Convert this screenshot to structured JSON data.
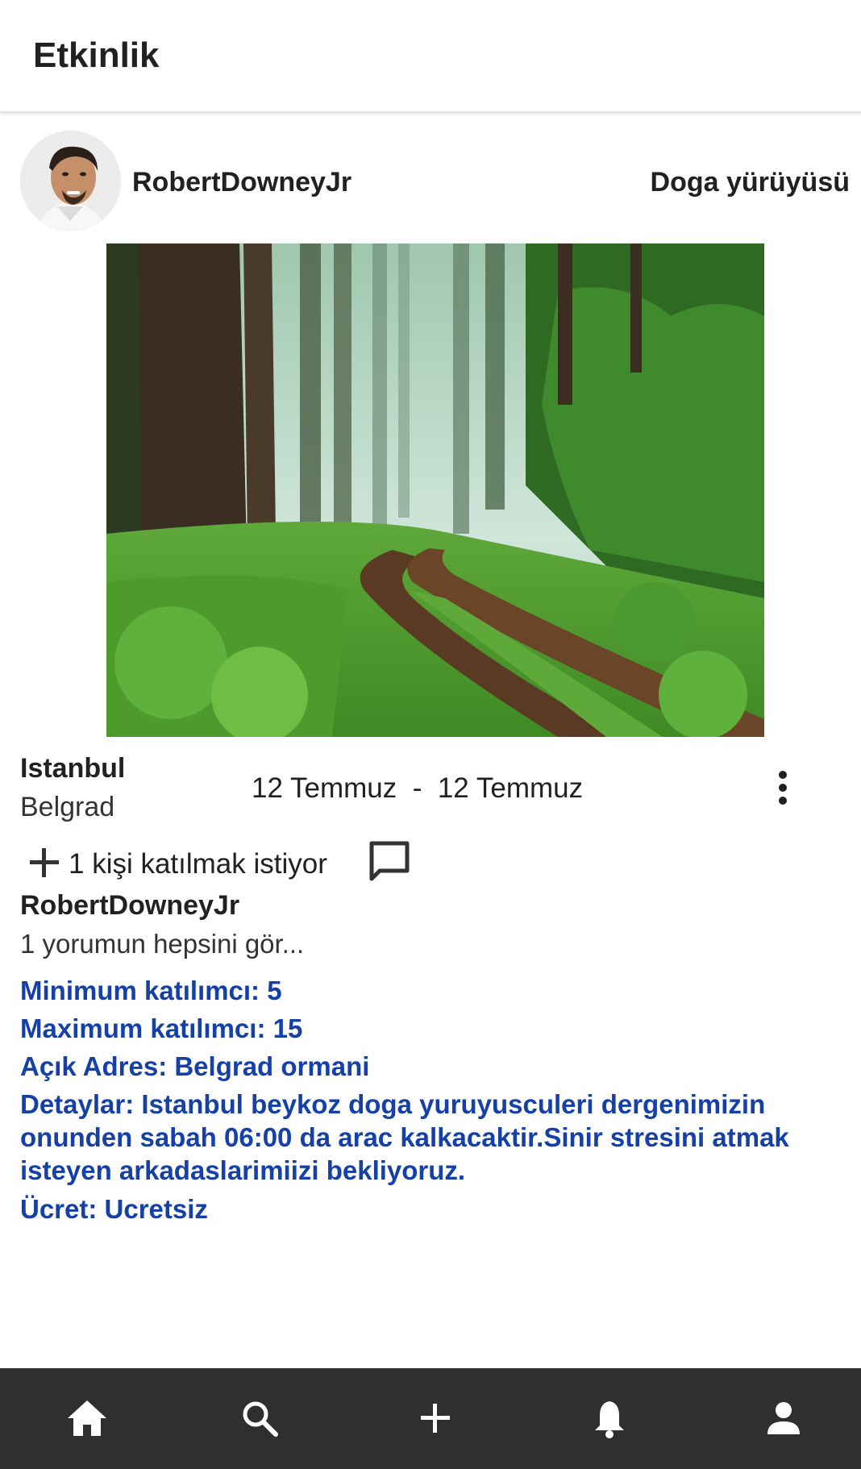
{
  "app_bar": {
    "title": "Etkinlik"
  },
  "post": {
    "username": "RobertDowneyJr",
    "event_name": "Doga yürüyüsü",
    "avatar_icon": "avatar-photo",
    "image_description_icon": "forest-photo"
  },
  "event": {
    "city": "Istanbul",
    "area": "Belgrad",
    "start_date": "12 Temmuz",
    "separator": "-",
    "end_date": "12 Temmuz"
  },
  "join": {
    "text": "1 kişi katılmak istiyor",
    "plus_icon": "plus-icon",
    "comment_icon": "comment-icon"
  },
  "comments": {
    "username": "RobertDowneyJr",
    "see_all": "1 yorumun hepsini gör..."
  },
  "details": {
    "min_participants": "Minimum katılımcı: 5",
    "max_participants": "Maximum katılımcı: 15",
    "address": "Açık Adres: Belgrad ormani",
    "description": "Detaylar: Istanbul beykoz doga yuruyusculeri dergenimizin onunden  sabah 06:00 da arac kalkacaktir.Sinir stresini atmak isteyen arkadaslarimiizi bekliyoruz.",
    "fee": "Ücret: Ucretsiz"
  },
  "colors": {
    "detail_text": "#1440a8",
    "nav_background": "#2f2f2f",
    "nav_icon": "#ffffff"
  },
  "bottom_nav": [
    {
      "icon": "home-icon"
    },
    {
      "icon": "search-icon"
    },
    {
      "icon": "add-icon"
    },
    {
      "icon": "bell-icon"
    },
    {
      "icon": "person-icon"
    }
  ]
}
